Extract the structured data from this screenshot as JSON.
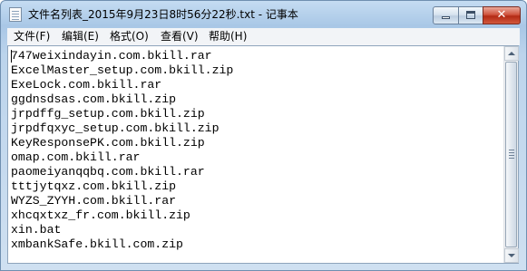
{
  "window": {
    "title": "文件名列表_2015年9月23日8时56分22秒.txt - 记事本",
    "controls": {
      "minimize": "minimize",
      "maximize": "maximize",
      "close": "✕"
    }
  },
  "menu": [
    {
      "label": "文件(F)"
    },
    {
      "label": "编辑(E)"
    },
    {
      "label": "格式(O)"
    },
    {
      "label": "查看(V)"
    },
    {
      "label": "帮助(H)"
    }
  ],
  "document": {
    "lines": [
      "747weixindayin.com.bkill.rar",
      "ExcelMaster_setup.com.bkill.zip",
      "ExeLock.com.bkill.rar",
      "ggdnsdsas.com.bkill.zip",
      "jrpdffg_setup.com.bkill.zip",
      "jrpdfqxyc_setup.com.bkill.zip",
      "KeyResponsePK.com.bkill.zip",
      "omap.com.bkill.rar",
      "paomeiyanqqbq.com.bkill.rar",
      "tttjytqxz.com.bkill.zip",
      "WYZS_ZYYH.com.bkill.rar",
      "xhcqxtxz_fr.com.bkill.zip",
      "xin.bat",
      "xmbankSafe.bkill.com.zip"
    ]
  }
}
